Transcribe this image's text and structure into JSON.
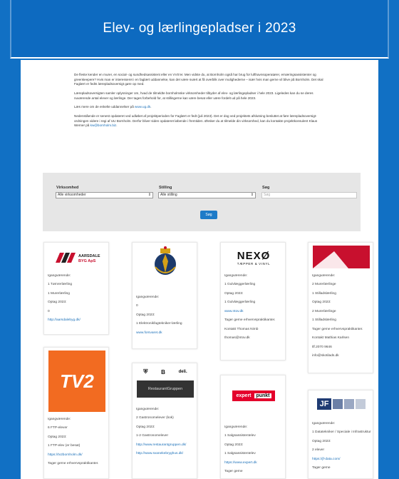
{
  "page": {
    "title": "Elev- og lærlingepladser i 2023"
  },
  "intro": {
    "p1": "De fleste kender en murer, en social- og sundhedsassistent eller en VVS'er. Men vidste du, at Bornholm også har brug for lufthavnsoperatører, ernæringsassistenter og greenkeepere? Hvis man er interesseret i en faglært uddannelse, kan det være svært at få overblik over mulighederne – især hvis man gerne vil blive på Bornholm. Det skal Faglært er fedts lærepladsoversigt gøre op med.",
    "p2": "Lærepladsoversigten samler oplysninger om, hvad de tilmeldte bornholmske virksomheder tilbyder af elev- og lærlingepladser i hele 2023. Ligeledes kan du se deres nuværende antal elever og lærlinge. Der tages forbehold for, at stillingerne kan være besat eller være fordelt ud på hele 2023.",
    "p3_text": "Læs mere om de enkelte uddannelser på ",
    "p3_link": "www.ug.dk",
    "p3_end": ".",
    "p4_text": "Nedenstående er senest opdateret ved udløbet af projektperioden for Faglært er fedt (juli 2023). Det er dog ved projektets afslutning besluttet at føre lærepladsoversigt-ordningen videre i regi af UU Bornholm. Derfor bliver siden opdateret løbende i fremtiden. Ønsker du at tilmelde din virksomhed, kan du kontakte projektkonsulent Klaus Werner på ",
    "p4_link": "kw@bornholm.biz",
    "p4_end": "."
  },
  "filters": {
    "virksomhed_label": "Virksomhed",
    "virksomhed_value": "Alle virksomheder",
    "stilling_label": "Stilling",
    "stilling_value": "Alle stilling",
    "search_label": "Søg",
    "search_placeholder": "Søg",
    "search_button": "Søg",
    "arrow": "⇕"
  },
  "cards": {
    "c1": {
      "logo_text": "AARSDALE BYG ApS",
      "l1": "Igangværende:",
      "l2": "1 Tømrerlærling",
      "l3": "1 Murerlærling",
      "l4": "Optag 2023:",
      "l5": "0",
      "link": "http://aarsdalebyg.dk/"
    },
    "c2": {
      "l1": "Igangværende:",
      "l2": "0",
      "l3": "Optag 2023:",
      "l4": "1 Elektronikfagtekniker-lærling",
      "link": "www.forsvaret.dk"
    },
    "c3": {
      "logo_text": "NEXØ",
      "logo_sub": "TÆPPER & VINYL",
      "l1": "Igangværende:",
      "l2": "1 Gulvlæggerlærling",
      "l3": "Optag 2023:",
      "l4": "1 Gulvlæggerlærling",
      "link": "www.ntov.dk",
      "l5": "Tager gerne erhvervspraktikanter.",
      "l6": "Kontakt Thomas Nimb",
      "l7": "thomas@ntov.dk"
    },
    "c4": {
      "l1": "Igangværende:",
      "l2": "2 Murerlærlinge",
      "l3": "1 Stilladslærling",
      "l4": "Optag 2023:",
      "l5": "2 Murerlærlinge",
      "l6": "1 Stilladslærling",
      "l7": "Tager gerne erhvervspraktikanter.",
      "l8": "Kontakt Mathias Karlsen",
      "l9": "tlf.2070 9646",
      "l10": "info@skotilads.dk"
    },
    "c5": {
      "logo_text": "TV2",
      "l1": "Igangværende:",
      "l2": "6 FTP-elever",
      "l3": "Optag 2023:",
      "l4": "1 FTP-elev (er besat)",
      "link": "https://tv2bornholm.dk/",
      "l5": "Tager gerne erhvervspraktikanter."
    },
    "c6": {
      "logo_b": "B",
      "logo_deli": "deli.",
      "logo_band": "RestaurantGruppen",
      "l1": "Igangværende:",
      "l2": "2 Gastronomelever (kok)",
      "l3": "Optag 2023:",
      "l4": "1-2 Gastronomelever",
      "link1": "http://www.restaurantgruppen.dk/",
      "link2": "http://www.svanekebryghus.dk/"
    },
    "c7": {
      "logo_text": "expert",
      "logo_sub": "punkt",
      "l1": "Igangværende:",
      "l2": "1 Salgsassistentelev",
      "l3": "Optag 2023:",
      "l4": "1 Salgsassistentelev",
      "link": "https://www.expert.dk",
      "l5": "Tager gerne"
    },
    "c8": {
      "logo_text": "JF",
      "l1": "Igangværende:",
      "l2": "1 Datatekniker / Speciale i Infrastruktur",
      "l3": "Optag 2023:",
      "l4": "2 elever",
      "link": "https://jf-data.com/",
      "l5": "Tager gerne"
    }
  },
  "colors": {
    "brand_blue": "#1170c4",
    "link": "#1a6fb8"
  }
}
